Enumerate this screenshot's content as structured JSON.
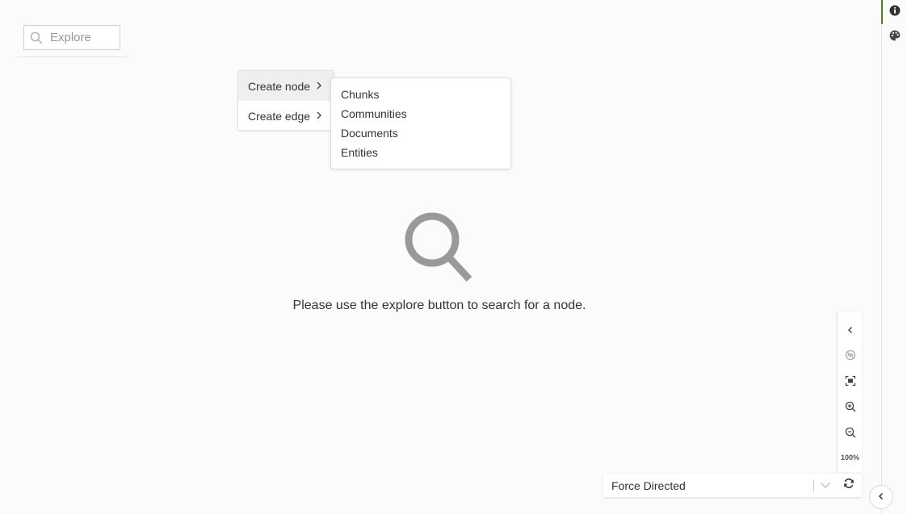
{
  "search": {
    "placeholder": "Explore",
    "icon": "search-icon"
  },
  "context_menu": {
    "items": [
      {
        "label": "Create node",
        "icon": "chevron-right-icon"
      },
      {
        "label": "Create edge",
        "icon": "chevron-right-icon"
      }
    ],
    "submenu": {
      "items": [
        "Chunks",
        "Communities",
        "Documents",
        "Entities"
      ]
    }
  },
  "empty_state": {
    "icon": "magnifier-icon",
    "message": "Please use the explore button to search for a node."
  },
  "right_rail": {
    "buttons": [
      {
        "icon": "info-icon",
        "active": true
      },
      {
        "icon": "palette-icon",
        "active": false
      }
    ],
    "accent_color": "#5a7a2c"
  },
  "zoom_toolbar": {
    "buttons": [
      "chevron-left-icon",
      "hide-icon",
      "fit-screen-icon",
      "zoom-in-icon",
      "zoom-out-icon"
    ],
    "zoom_level": "100%"
  },
  "layout_select": {
    "value": "Force Directed",
    "dropdown_icon": "chevron-down-icon",
    "refresh_icon": "refresh-icon"
  },
  "collapse_button": {
    "icon": "chevron-left-icon"
  }
}
